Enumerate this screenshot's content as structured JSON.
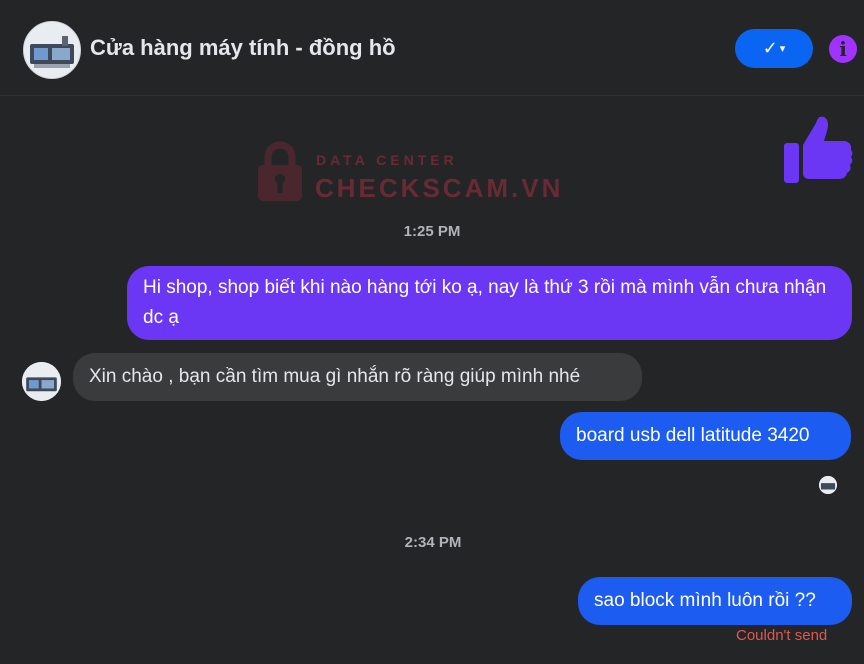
{
  "header": {
    "title": "Cửa hàng máy tính - đồng hồ",
    "check_label": "✓",
    "check_dropdown": "▾",
    "info_label": "i",
    "avatar": "shop-avatar"
  },
  "watermark": {
    "subtitle": "DATA CENTER",
    "brand": "CHECKSCAM.VN",
    "icon": "lock-icon"
  },
  "like_sticker": "thumbs-up-icon",
  "messages": {
    "t1": "1:25 PM",
    "m1": "Hi shop, shop biết khi nào hàng tới ko ạ, nay là thứ 3 rồi mà mình vẫn chưa nhận dc ạ",
    "m2": "Xin chào , bạn cần tìm mua gì nhắn rõ ràng giúp mình nhé",
    "m3": "board usb dell latitude 3420",
    "t2": "2:34 PM",
    "m4": "sao block mình luôn rồi ??",
    "m4_status": "Couldn't send"
  },
  "colors": {
    "background": "#242526",
    "outgoing_purple": "#6c36f5",
    "outgoing_blue": "#1d5cf0",
    "incoming_gray": "#3a3b3c",
    "accent_blue": "#0a66f2",
    "info_purple": "#a033ff",
    "error_red": "#e2574c"
  }
}
